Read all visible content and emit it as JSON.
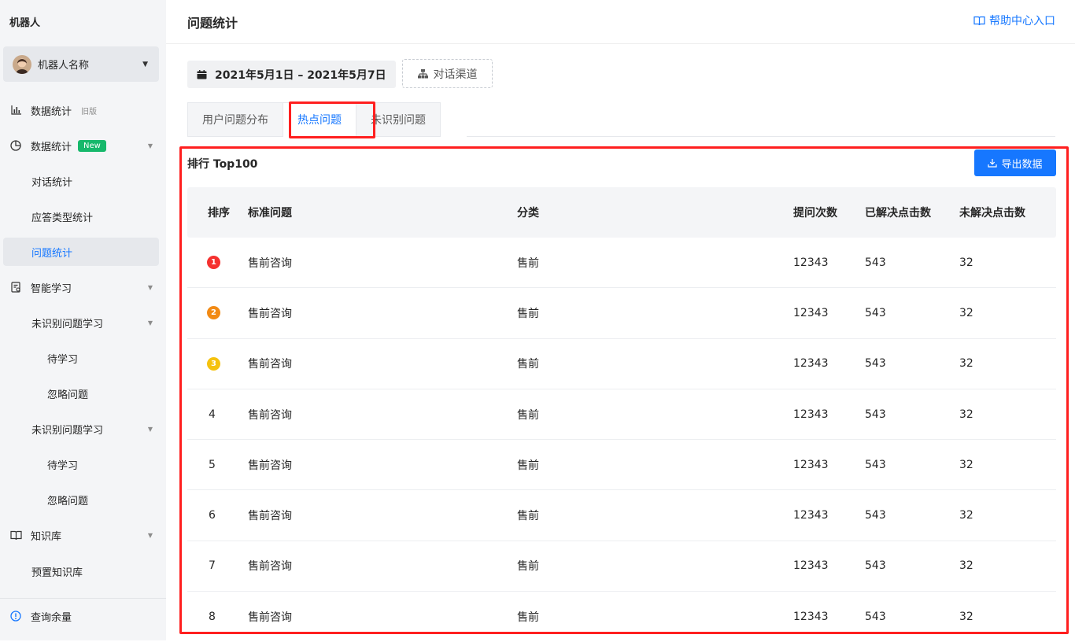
{
  "app": {
    "title": "机器人"
  },
  "robot": {
    "name": "机器人名称"
  },
  "sidebar": {
    "items": [
      {
        "label": "数据统计",
        "tag": "旧版"
      },
      {
        "label": "数据统计",
        "tag": "New"
      },
      {
        "label": "对话统计"
      },
      {
        "label": "应答类型统计"
      },
      {
        "label": "问题统计"
      },
      {
        "label": "智能学习"
      },
      {
        "label": "未识别问题学习"
      },
      {
        "label": "待学习"
      },
      {
        "label": "忽略问题"
      },
      {
        "label": "未识别问题学习"
      },
      {
        "label": "待学习"
      },
      {
        "label": "忽略问题"
      },
      {
        "label": "知识库"
      },
      {
        "label": "预置知识库"
      },
      {
        "label": "查询余量"
      }
    ]
  },
  "header": {
    "title": "问题统计",
    "help": "帮助中心入口"
  },
  "filters": {
    "date_range": "2021年5月1日 – 2021年5月7日",
    "channel": "对话渠道"
  },
  "tabs": [
    {
      "label": "用户问题分布"
    },
    {
      "label": "热点问题"
    },
    {
      "label": "未识别问题"
    }
  ],
  "panel": {
    "title": "排行 Top100",
    "export": "导出数据"
  },
  "table": {
    "columns": [
      "排序",
      "标准问题",
      "分类",
      "提问次数",
      "已解决点击数",
      "未解决点击数"
    ],
    "rows": [
      {
        "rank": "1",
        "question": "售前咨询",
        "category": "售前",
        "asks": "12343",
        "solved": "543",
        "unsolved": "32"
      },
      {
        "rank": "2",
        "question": "售前咨询",
        "category": "售前",
        "asks": "12343",
        "solved": "543",
        "unsolved": "32"
      },
      {
        "rank": "3",
        "question": "售前咨询",
        "category": "售前",
        "asks": "12343",
        "solved": "543",
        "unsolved": "32"
      },
      {
        "rank": "4",
        "question": "售前咨询",
        "category": "售前",
        "asks": "12343",
        "solved": "543",
        "unsolved": "32"
      },
      {
        "rank": "5",
        "question": "售前咨询",
        "category": "售前",
        "asks": "12343",
        "solved": "543",
        "unsolved": "32"
      },
      {
        "rank": "6",
        "question": "售前咨询",
        "category": "售前",
        "asks": "12343",
        "solved": "543",
        "unsolved": "32"
      },
      {
        "rank": "7",
        "question": "售前咨询",
        "category": "售前",
        "asks": "12343",
        "solved": "543",
        "unsolved": "32"
      },
      {
        "rank": "8",
        "question": "售前咨询",
        "category": "售前",
        "asks": "12343",
        "solved": "543",
        "unsolved": "32"
      }
    ]
  },
  "colors": {
    "accent": "#1677ff",
    "highlight": "#ff1f1f",
    "new_tag": "#16b86b",
    "medal_1": "#f5312f",
    "medal_2": "#f28a14",
    "medal_3": "#f5c20e"
  }
}
